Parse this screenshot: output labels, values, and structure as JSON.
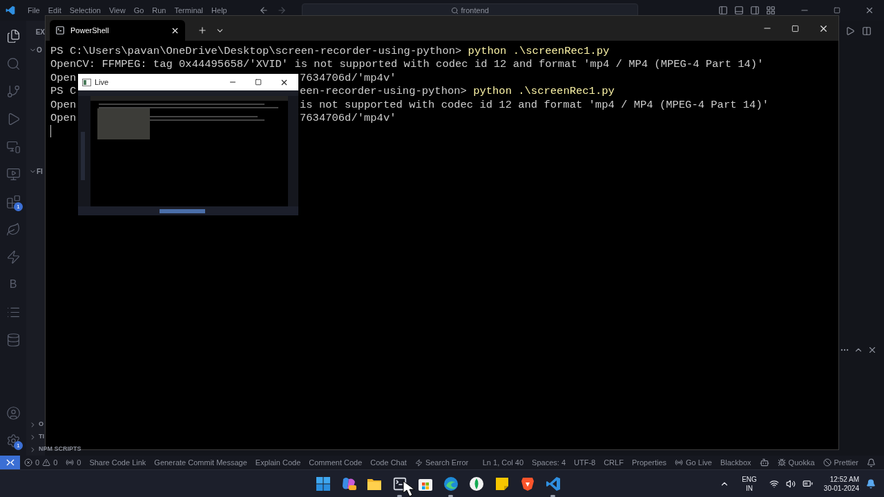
{
  "menu": [
    "File",
    "Edit",
    "Selection",
    "View",
    "Go",
    "Run",
    "Terminal",
    "Help"
  ],
  "command_center": {
    "text": "frontend"
  },
  "activity_bar": [
    {
      "kind": "files",
      "selected": true
    },
    {
      "kind": "search",
      "selected": false
    },
    {
      "kind": "git",
      "selected": false
    },
    {
      "kind": "run",
      "selected": false
    },
    {
      "kind": "remote",
      "selected": false
    },
    {
      "kind": "preview",
      "selected": false
    },
    {
      "kind": "extensions",
      "selected": false,
      "badge": "1"
    },
    {
      "kind": "leaf",
      "selected": false
    },
    {
      "kind": "bolt",
      "selected": false
    },
    {
      "kind": "letter",
      "selected": false,
      "text": "B"
    },
    {
      "kind": "list",
      "selected": false
    },
    {
      "kind": "database",
      "selected": false
    }
  ],
  "activity_bottom": [
    {
      "kind": "account"
    },
    {
      "kind": "settings",
      "badge": "1"
    }
  ],
  "sidebar_top": [
    {
      "label": "EX"
    },
    {
      "label": "O",
      "expanded": true
    },
    {
      "label": "FI",
      "expanded": true
    }
  ],
  "sidebar_bottom": [
    {
      "label": "O",
      "expanded": false
    },
    {
      "label": "TI",
      "expanded": false
    },
    {
      "label": "NPM SCRIPTS",
      "expanded": false
    }
  ],
  "terminal": {
    "tab": "PowerShell",
    "lines": [
      {
        "left": "PS C:\\Users\\pavan\\OneDrive\\Desktop\\screen-recorder-using-python> ",
        "command": "python .\\screenRec1.py"
      },
      {
        "left": "OpenCV: FFMPEG: tag 0x44495658/'XVID' is not supported with codec id 12 and format 'mp4 / MP4 (MPEG-4 Part 14)'"
      },
      {
        "left": "Open",
        "right": "7634706d/'mp4v'"
      },
      {
        "left": "PS C",
        "right": "een-recorder-using-python> ",
        "command": "python .\\screenRec1.py"
      },
      {
        "left": "Open",
        "right": "is not supported with codec id 12 and format 'mp4 / MP4 (MPEG-4 Part 14)'"
      },
      {
        "left": "Open",
        "right": "7634706d/'mp4v'"
      }
    ]
  },
  "live_window": {
    "title": "Live"
  },
  "status_bar": {
    "left": [
      {
        "kind": "remote"
      },
      {
        "kind": "problems",
        "errors": "0",
        "warnings": "0"
      },
      {
        "kind": "ports",
        "text": "0"
      },
      {
        "kind": "text",
        "text": "Share Code Link"
      },
      {
        "kind": "text",
        "text": "Generate Commit Message"
      },
      {
        "kind": "text",
        "text": "Explain Code"
      },
      {
        "kind": "text",
        "text": "Comment Code"
      },
      {
        "kind": "text",
        "text": "Code Chat"
      },
      {
        "kind": "search",
        "text": "Search Error"
      }
    ],
    "right": [
      {
        "kind": "text",
        "text": "Ln 1, Col 40"
      },
      {
        "kind": "text",
        "text": "Spaces: 4"
      },
      {
        "kind": "text",
        "text": "UTF-8"
      },
      {
        "kind": "text",
        "text": "CRLF"
      },
      {
        "kind": "text",
        "text": "Properties"
      },
      {
        "kind": "live",
        "text": "Go Live"
      },
      {
        "kind": "text",
        "text": "Blackbox"
      },
      {
        "kind": "copilot"
      },
      {
        "kind": "quokka",
        "text": "Quokka"
      },
      {
        "kind": "prettier",
        "text": "Prettier"
      },
      {
        "kind": "bell"
      }
    ]
  },
  "taskbar": {
    "apps": [
      {
        "kind": "start",
        "running": false
      },
      {
        "kind": "copilot",
        "running": false
      },
      {
        "kind": "folder",
        "running": false
      },
      {
        "kind": "terminal",
        "running": true
      },
      {
        "kind": "store",
        "running": false
      },
      {
        "kind": "edge",
        "running": true
      },
      {
        "kind": "leaf",
        "running": false
      },
      {
        "kind": "notes",
        "running": false
      },
      {
        "kind": "brave",
        "running": false
      },
      {
        "kind": "vscode",
        "running": true
      }
    ],
    "language": "ENG",
    "region": "IN",
    "time": "12:52 AM",
    "date": "30-01-2024"
  }
}
